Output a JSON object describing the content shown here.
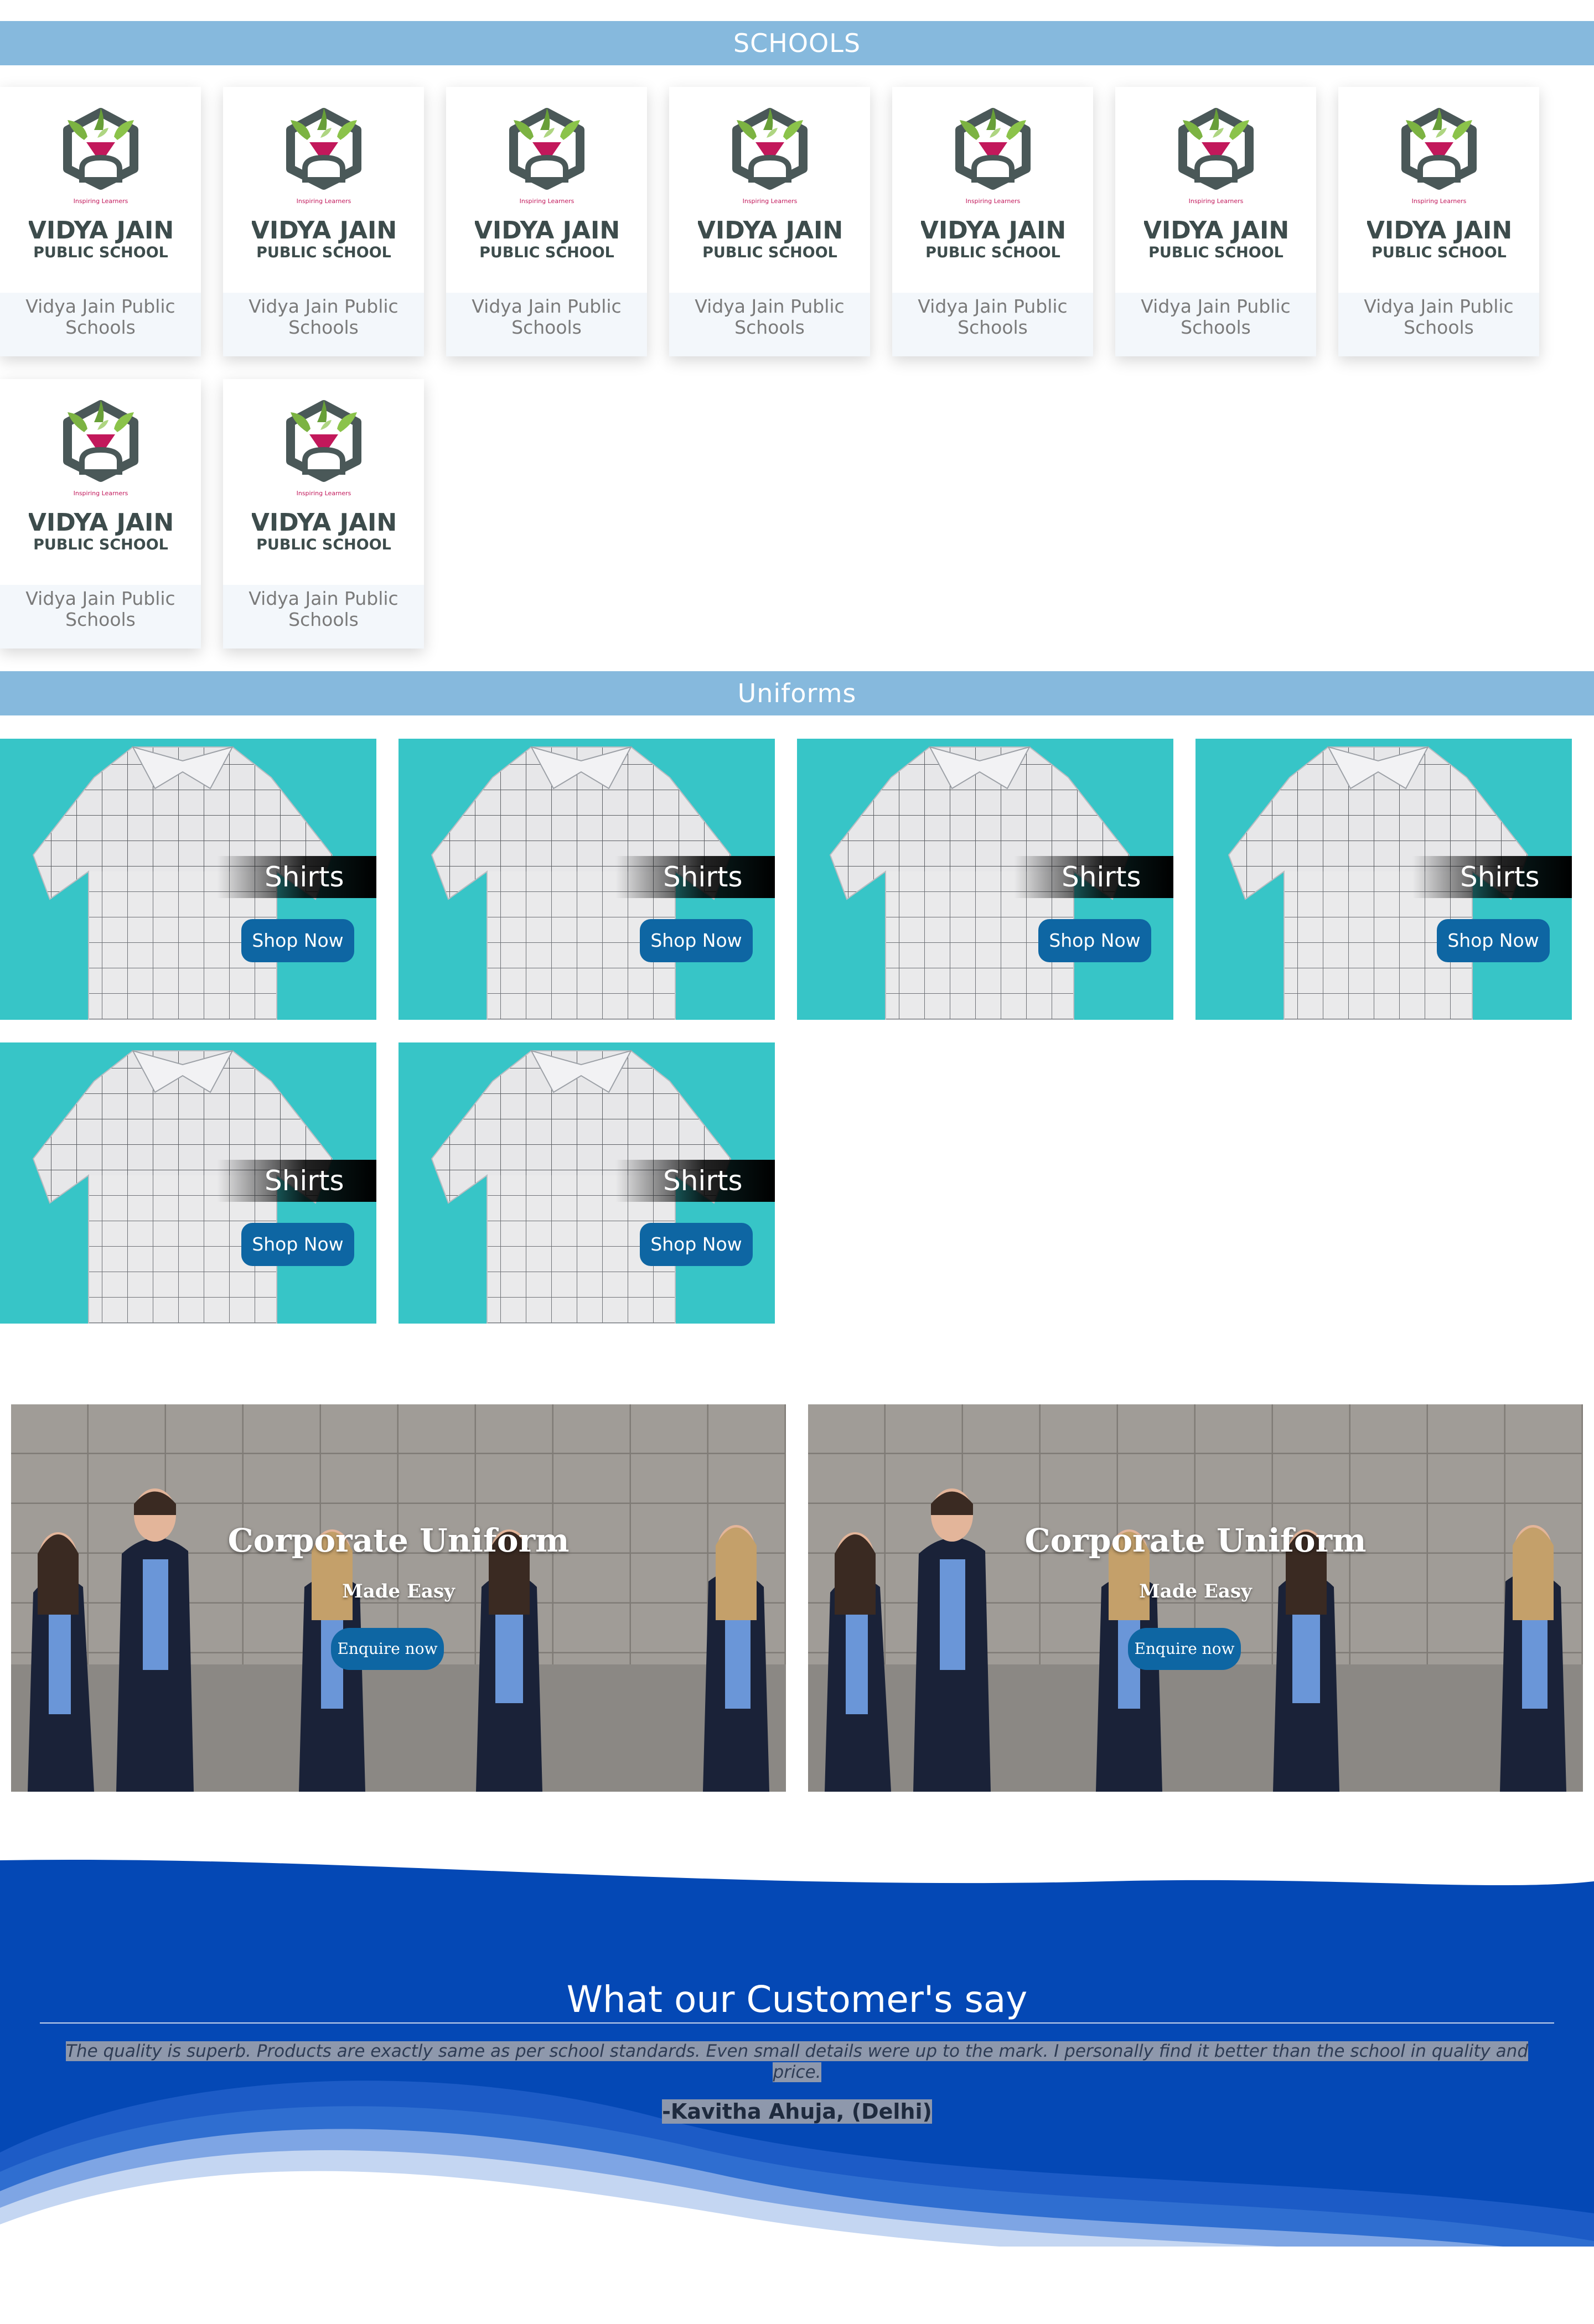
{
  "schools_section": {
    "title": "SCHOOLS",
    "logo": {
      "tagline": "Inspiring Learners",
      "line1": "VIDYA JAIN",
      "line2": "PUBLIC SCHOOL"
    },
    "cards": [
      {
        "name": "Vidya Jain Public Schools"
      },
      {
        "name": "Vidya Jain Public Schools"
      },
      {
        "name": "Vidya Jain Public Schools"
      },
      {
        "name": "Vidya Jain Public Schools"
      },
      {
        "name": "Vidya Jain Public Schools"
      },
      {
        "name": "Vidya Jain Public Schools"
      },
      {
        "name": "Vidya Jain Public Schools"
      },
      {
        "name": "Vidya Jain Public Schools"
      },
      {
        "name": "Vidya Jain Public Schools"
      }
    ]
  },
  "uniforms_section": {
    "title": "Uniforms",
    "tiles": [
      {
        "title": "Shirts",
        "button": "Shop Now"
      },
      {
        "title": "Shirts",
        "button": "Shop Now"
      },
      {
        "title": "Shirts",
        "button": "Shop Now"
      },
      {
        "title": "Shirts",
        "button": "Shop Now"
      },
      {
        "title": "Shirts",
        "button": "Shop Now"
      },
      {
        "title": "Shirts",
        "button": "Shop Now"
      }
    ]
  },
  "corporate_banners": [
    {
      "title": "Corporate Uniform",
      "subtitle": "Made Easy",
      "button": "Enquire now"
    },
    {
      "title": "Corporate Uniform",
      "subtitle": "Made Easy",
      "button": "Enquire now"
    }
  ],
  "testimonials": {
    "heading": "What our Customer's say",
    "quote": "The quality is superb. Products are exactly same as per school standards. Even small details were up to the mark. I personally find it better than the school in quality and price.",
    "author": "-Kavitha Ahuja, (Delhi)"
  },
  "colors": {
    "section_bar": "#86b9dd",
    "button_blue": "#0e66a3",
    "tile_teal": "#37c5c7",
    "wave_blue": "#0448b5"
  }
}
